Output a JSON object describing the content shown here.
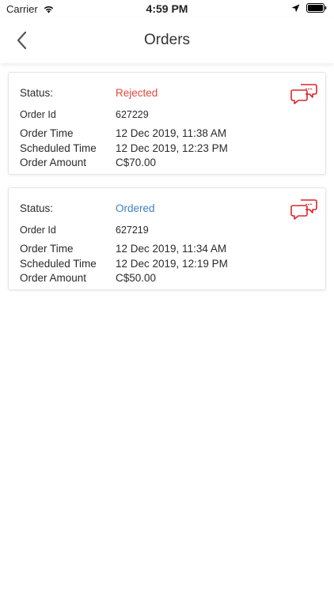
{
  "status_bar": {
    "carrier": "Carrier",
    "time": "4:59 PM"
  },
  "nav": {
    "title": "Orders"
  },
  "labels": {
    "status": "Status:",
    "order_id": "Order Id",
    "order_time": "Order Time",
    "scheduled_time": "Scheduled Time",
    "order_amount": "Order Amount"
  },
  "orders": [
    {
      "status": "Rejected",
      "status_color": "#e0493a",
      "order_id": "627229",
      "order_time": "12 Dec 2019, 11:38 AM",
      "scheduled_time": "12 Dec 2019, 12:23 PM",
      "order_amount": "C$70.00"
    },
    {
      "status": "Ordered",
      "status_color": "#3f7fc2",
      "order_id": "627219",
      "order_time": "12 Dec 2019, 11:34 AM",
      "scheduled_time": "12 Dec 2019, 12:19 PM",
      "order_amount": "C$50.00"
    }
  ],
  "colors": {
    "chat_icon": "#d7262b"
  }
}
